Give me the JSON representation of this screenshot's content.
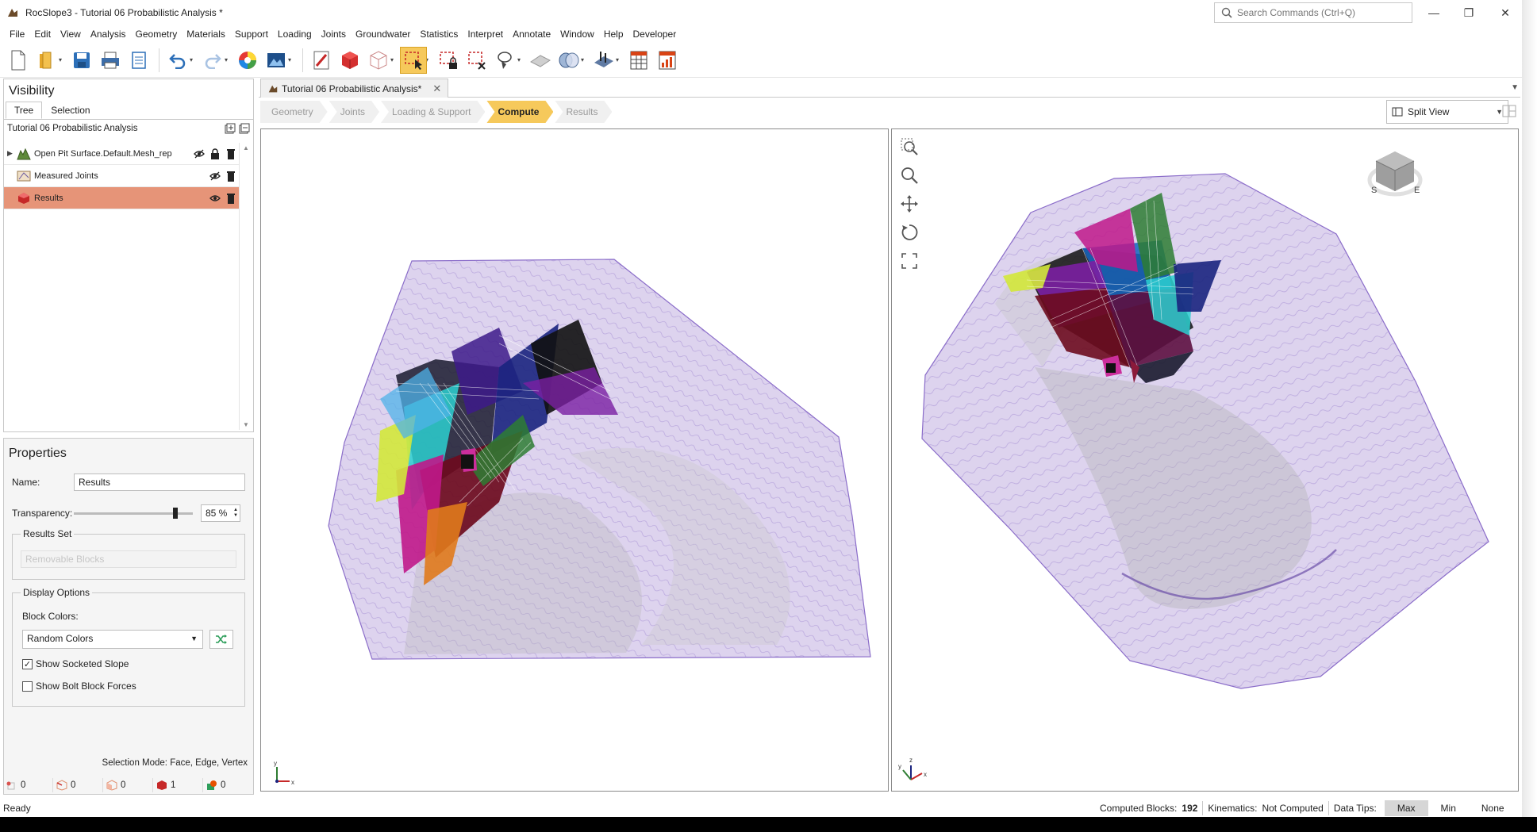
{
  "window": {
    "title": "RocSlope3 - Tutorial 06 Probabilistic Analysis *",
    "search_placeholder": "Search Commands (Ctrl+Q)",
    "minimize": "—",
    "restore": "❐",
    "close": "✕"
  },
  "menu": [
    "File",
    "Edit",
    "View",
    "Analysis",
    "Geometry",
    "Materials",
    "Support",
    "Loading",
    "Joints",
    "Groundwater",
    "Statistics",
    "Interpret",
    "Annotate",
    "Window",
    "Help",
    "Developer"
  ],
  "toolbar": {
    "icons": [
      "new-file-icon",
      "open-folder-icon",
      "save-icon",
      "print-icon",
      "report-icon",
      "undo-icon",
      "redo-icon",
      "color-wheel-icon",
      "image-export-icon",
      "measure-icon",
      "solid-block-icon",
      "wireframe-block-icon",
      "select-icon",
      "lock-select-icon",
      "deselect-icon",
      "lasso-icon",
      "surface-icon",
      "joint-icon",
      "support-icon",
      "table-icon",
      "chart-table-icon"
    ],
    "active": "select-icon"
  },
  "visibility": {
    "title": "Visibility",
    "tabs": [
      "Tree",
      "Selection"
    ],
    "root_label": "Tutorial 06 Probabilistic Analysis",
    "items": [
      {
        "label": "Open Pit Surface.Default.Mesh_rep",
        "icon": "mesh-surface-icon",
        "expandable": true
      },
      {
        "label": "Measured Joints",
        "icon": "joints-icon",
        "expandable": false
      },
      {
        "label": "Results",
        "icon": "results-icon",
        "expandable": false,
        "selected": true
      }
    ]
  },
  "properties": {
    "title": "Properties",
    "name_label": "Name:",
    "name_value": "Results",
    "transparency_label": "Transparency:",
    "transparency_value": "85 %",
    "transparency_fraction": 0.85,
    "results_set_title": "Results Set",
    "results_set_value": "Removable Blocks",
    "display_options_title": "Display Options",
    "block_colors_label": "Block Colors:",
    "block_colors_value": "Random Colors",
    "show_socketed_slope_label": "Show Socketed Slope",
    "show_socketed_slope_checked": true,
    "show_bolt_block_forces_label": "Show Bolt Block Forces",
    "show_bolt_block_forces_checked": false
  },
  "selection": {
    "mode_text": "Selection Mode: Face, Edge, Vertex",
    "counters": [
      {
        "icon": "vertex-count-icon",
        "value": "0",
        "color": "#d9534f"
      },
      {
        "icon": "edge-count-icon",
        "value": "0",
        "color": "#e09070"
      },
      {
        "icon": "face-count-icon",
        "value": "0",
        "color": "#e09070"
      },
      {
        "icon": "block-count-icon",
        "value": "1",
        "color": "#c62828"
      },
      {
        "icon": "joint-count-icon",
        "value": "0",
        "color": "#2e9e5b"
      }
    ]
  },
  "document": {
    "tab_label": "Tutorial 06 Probabilistic Analysis*",
    "tab_close": "✕"
  },
  "workflow": {
    "steps": [
      "Geometry",
      "Joints",
      "Loading & Support",
      "Compute",
      "Results"
    ],
    "active": "Compute"
  },
  "view_mode": {
    "label": "Split View"
  },
  "viewports": {
    "right_cube_labels": [
      "S",
      "E"
    ],
    "axis_labels": [
      "x",
      "y",
      "z"
    ]
  },
  "statusbar": {
    "ready": "Ready",
    "computed_blocks_label": "Computed Blocks:",
    "computed_blocks_value": "192",
    "kinematics_label": "Kinematics:",
    "kinematics_value": "Not Computed",
    "data_tips_label": "Data Tips:",
    "data_tips_options": [
      "Max",
      "Min",
      "None"
    ],
    "data_tips_active": "Max"
  },
  "colors": {
    "accent": "#f6c95b",
    "selected_row": "#e69478",
    "surface_fill": "#ddd3ee",
    "surface_line": "#8a6cc9"
  }
}
